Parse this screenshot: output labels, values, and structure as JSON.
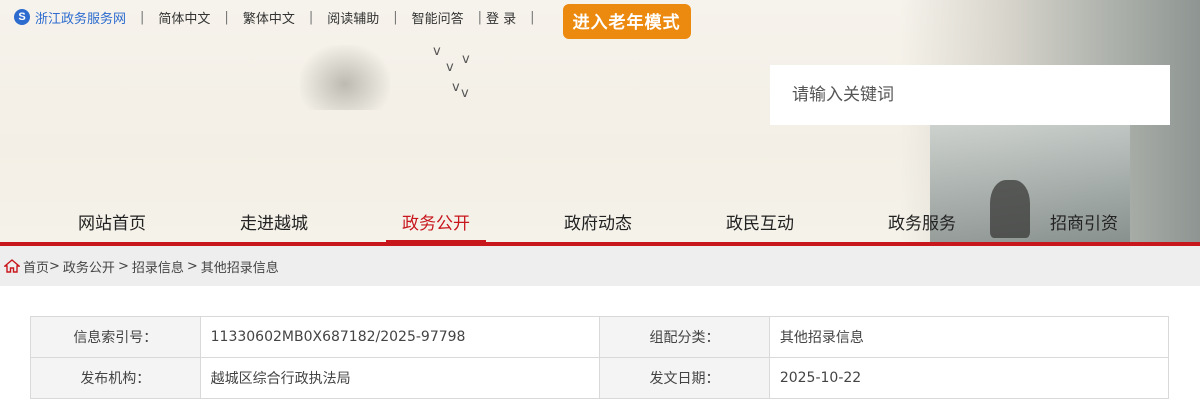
{
  "header": {
    "site_logo_glyph": "S",
    "site_name": "浙江政务服务网",
    "links": [
      "简体中文",
      "繁体中文",
      "阅读辅助",
      "智能问答",
      "登 录"
    ],
    "elder_mode_button": "进入老年模式",
    "bird_glyph": "v",
    "search": {
      "placeholder": "请输入关键词"
    }
  },
  "nav": {
    "items": [
      "网站首页",
      "走进越城",
      "政务公开",
      "政府动态",
      "政民互动",
      "政务服务",
      "招商引资"
    ],
    "active": "政务公开"
  },
  "breadcrumb": {
    "separator": ">",
    "items": [
      "首页",
      "政务公开",
      "招录信息",
      "其他招录信息"
    ]
  },
  "info_table": {
    "rows": [
      [
        "信息索引号：",
        "11330602MB0X687182/2025-97798",
        "组配分类：",
        "其他招录信息"
      ],
      [
        "发布机构：",
        "越城区综合行政执法局",
        "发文日期：",
        "2025-10-22"
      ]
    ]
  },
  "colors": {
    "accent_red": "#c8161d",
    "elder_button_orange": "#ec8a10",
    "site_name_blue": "#2d6bcf"
  }
}
